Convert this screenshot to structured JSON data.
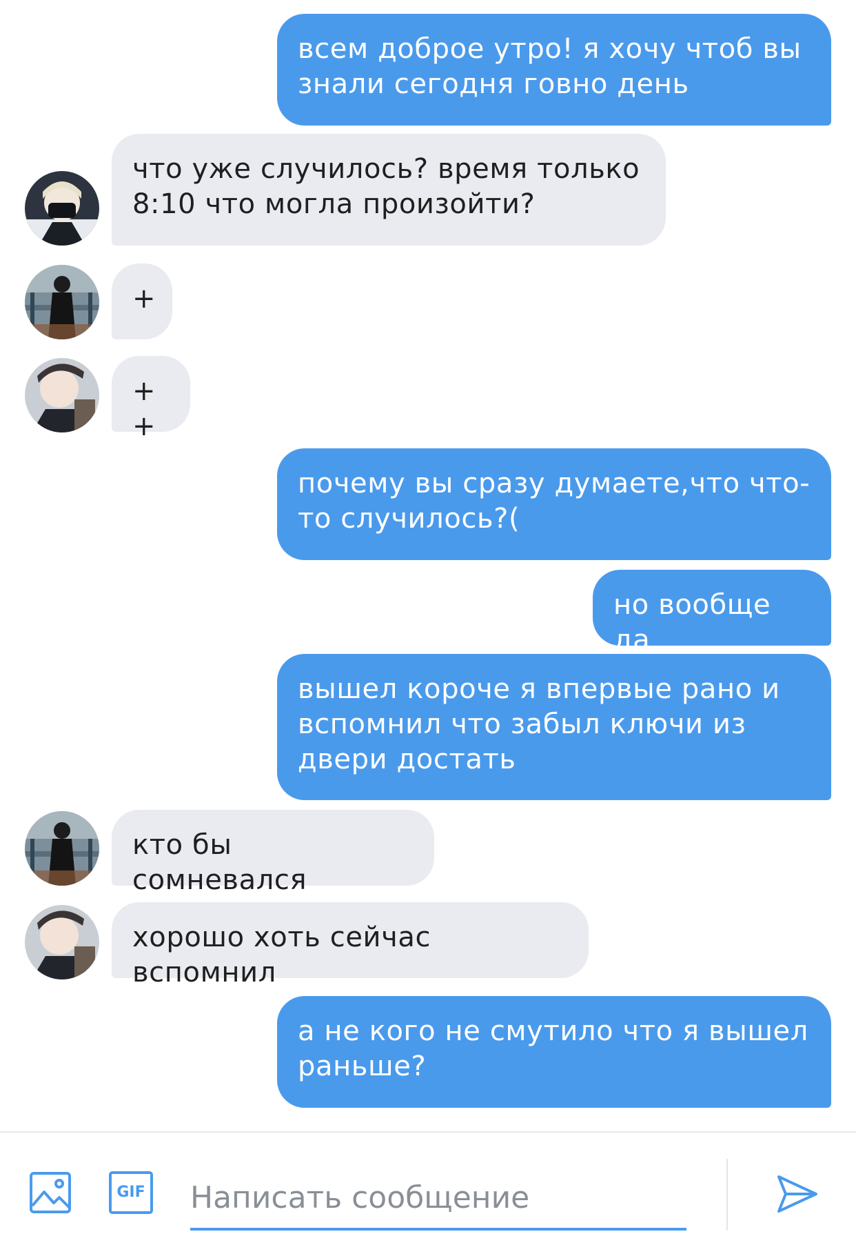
{
  "messages": [
    {
      "from": "me",
      "text": "всем доброе утро! я хочу чтоб вы знали сегодня говно день"
    },
    {
      "from": "user1",
      "text": "что уже случилось? время только 8:10 что могла произойти?"
    },
    {
      "from": "user2",
      "text": "+"
    },
    {
      "from": "user3",
      "text": "++"
    },
    {
      "from": "me",
      "text": "почему вы сразу думаете,что что-то случилось?("
    },
    {
      "from": "me",
      "text": "но вообще да"
    },
    {
      "from": "me",
      "text": "вышел короче я впервые рано и вспомнил что забыл ключи из двери достать"
    },
    {
      "from": "user2",
      "text": "кто бы сомневался"
    },
    {
      "from": "user3",
      "text": "хорошо хоть сейчас вспомнил"
    },
    {
      "from": "me",
      "text": "а не кого не смутило что я вышел раньше?"
    }
  ],
  "composer": {
    "placeholder": "Написать сообщение",
    "gif_label": "GIF",
    "image_icon": "image-icon",
    "send_icon": "send-icon"
  },
  "colors": {
    "outgoing_bubble": "#4a9aec",
    "incoming_bubble": "#e9ebf1",
    "accent": "#4a9aec"
  }
}
